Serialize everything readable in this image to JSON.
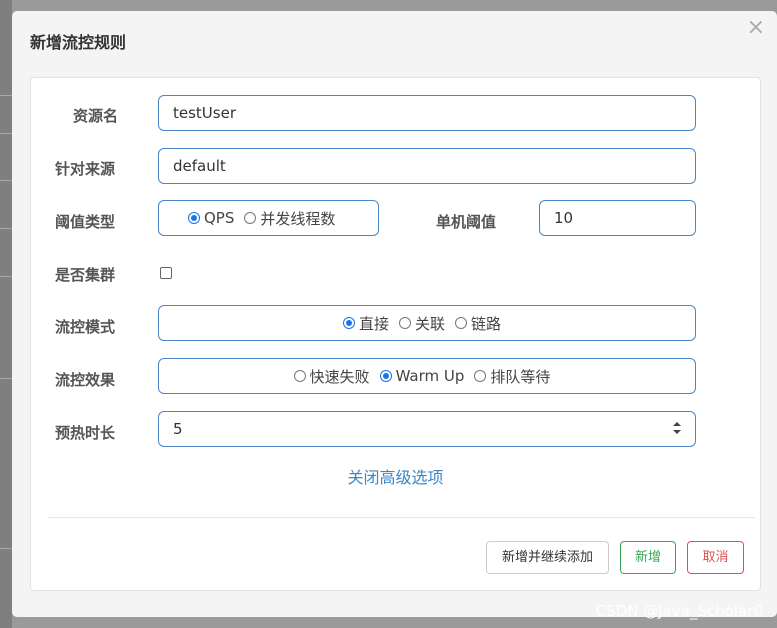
{
  "modal": {
    "title": "新增流控规则",
    "close_label": "×"
  },
  "form": {
    "resource": {
      "label": "资源名",
      "value": "testUser"
    },
    "origin": {
      "label": "针对来源",
      "value": "default"
    },
    "threshold_type": {
      "label": "阈值类型",
      "options": [
        "QPS",
        "并发线程数"
      ],
      "selected": "QPS"
    },
    "threshold": {
      "label": "单机阈值",
      "value": "10"
    },
    "cluster": {
      "label": "是否集群",
      "checked": false
    },
    "control_mode": {
      "label": "流控模式",
      "options": [
        "直接",
        "关联",
        "链路"
      ],
      "selected": "直接"
    },
    "control_effect": {
      "label": "流控效果",
      "options": [
        "快速失败",
        "Warm Up",
        "排队等待"
      ],
      "selected": "Warm Up"
    },
    "warmup": {
      "label": "预热时长",
      "value": "5"
    },
    "advanced_toggle": "关闭高级选项"
  },
  "buttons": {
    "add_continue": "新增并继续添加",
    "add": "新增",
    "cancel": "取消"
  },
  "watermark": "CSDN @Java_Scholar0",
  "colors": {
    "input_border": "#4a86c8",
    "radio_selected": "#1a73e8",
    "add_button": "#3aa757",
    "cancel_button": "#d9534f",
    "link": "#3a87c8"
  }
}
